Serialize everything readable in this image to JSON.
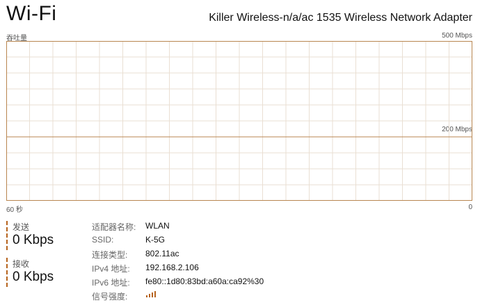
{
  "header": {
    "title": "Wi-Fi",
    "adapter": "Killer Wireless-n/a/ac 1535 Wireless Network Adapter"
  },
  "graph": {
    "y_label": "吞吐量",
    "y_max_label": "500 Mbps",
    "y_mid_label": "200 Mbps",
    "x_left_label": "60 秒",
    "x_right_label": "0"
  },
  "colors": {
    "accent": "#b6631d",
    "fill": "#fcefe2",
    "grid": "#eadfd3",
    "border": "#b98650"
  },
  "chart_data": {
    "type": "area",
    "x_range": [
      60,
      0
    ],
    "y_range": [
      0,
      500
    ],
    "y_unit": "Mbps",
    "reference_line": 200,
    "grid": true,
    "values": [
      0,
      0,
      0,
      0,
      0,
      0,
      0,
      0,
      0,
      0,
      0,
      0,
      0,
      0,
      0,
      0,
      0,
      0,
      0,
      0,
      0,
      0,
      0,
      0,
      0,
      0,
      0,
      0,
      0,
      0,
      0,
      0,
      0,
      0,
      0,
      0,
      0,
      0,
      0,
      0,
      0,
      0,
      0,
      0,
      0,
      0,
      0,
      0,
      0,
      0,
      0,
      0,
      0,
      0,
      0,
      0,
      0,
      0,
      0,
      0,
      0
    ]
  },
  "stats": {
    "send": {
      "label": "发送",
      "value": "0 Kbps"
    },
    "receive": {
      "label": "接收",
      "value": "0 Kbps"
    }
  },
  "properties": [
    {
      "key": "适配器名称:",
      "value": "WLAN"
    },
    {
      "key": "SSID:",
      "value": "K-5G"
    },
    {
      "key": "连接类型:",
      "value": "802.11ac"
    },
    {
      "key": "IPv4 地址:",
      "value": "192.168.2.106"
    },
    {
      "key": "IPv6 地址:",
      "value": "fe80::1d80:83bd:a60a:ca92%30"
    },
    {
      "key": "信号强度:",
      "value": "",
      "icon": "signal-strength-icon",
      "bars": 4,
      "bars_filled": 4
    }
  ]
}
